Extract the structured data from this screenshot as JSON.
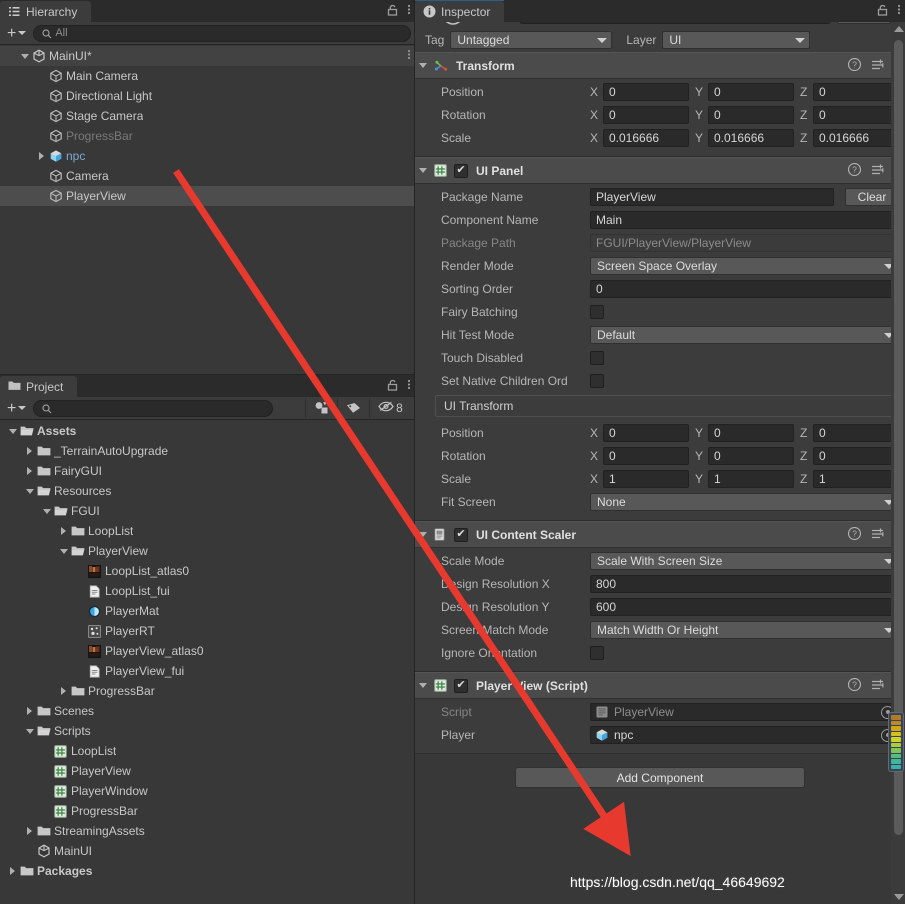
{
  "hierarchy": {
    "tab_label": "Hierarchy",
    "tab_icon": "hierarchy-icon",
    "toolbar": {
      "add_label": "+",
      "search_placeholder": "All",
      "search_value": ""
    },
    "items": [
      {
        "label": "MainUI*",
        "icon": "unity-scene-icon",
        "indent": 0,
        "expanded": true,
        "state": "scene-header",
        "kebab": true
      },
      {
        "label": "Main Camera",
        "icon": "gameobject-cube-icon",
        "indent": 1,
        "expanded": null,
        "state": "normal"
      },
      {
        "label": "Directional Light",
        "icon": "gameobject-cube-icon",
        "indent": 1,
        "expanded": null,
        "state": "normal"
      },
      {
        "label": "Stage Camera",
        "icon": "gameobject-cube-icon",
        "indent": 1,
        "expanded": null,
        "state": "normal"
      },
      {
        "label": "ProgressBar",
        "icon": "gameobject-cube-icon",
        "indent": 1,
        "expanded": null,
        "state": "disabled"
      },
      {
        "label": "npc",
        "icon": "prefab-cube-icon",
        "indent": 1,
        "expanded": false,
        "state": "prefab"
      },
      {
        "label": "Camera",
        "icon": "gameobject-cube-icon",
        "indent": 1,
        "expanded": null,
        "state": "normal"
      },
      {
        "label": "PlayerView",
        "icon": "gameobject-cube-icon",
        "indent": 1,
        "expanded": null,
        "state": "selected"
      }
    ]
  },
  "project": {
    "tab_label": "Project",
    "tab_icon": "folder-icon",
    "toolbar": {
      "add_label": "+",
      "search_placeholder": "",
      "search_value": "",
      "filter_type_icon": "filter-by-type-icon",
      "filter_label_icon": "filter-by-label-icon",
      "hidden_count_icon": "visibility-off-icon",
      "hidden_count": "8"
    },
    "items": [
      {
        "label": "Assets",
        "icon": "folder-open-icon",
        "indent": 0,
        "expanded": true,
        "bold": true
      },
      {
        "label": "_TerrainAutoUpgrade",
        "icon": "folder-icon",
        "indent": 1,
        "expanded": false
      },
      {
        "label": "FairyGUI",
        "icon": "folder-icon",
        "indent": 1,
        "expanded": false
      },
      {
        "label": "Resources",
        "icon": "folder-open-icon",
        "indent": 1,
        "expanded": true
      },
      {
        "label": "FGUI",
        "icon": "folder-open-icon",
        "indent": 2,
        "expanded": true
      },
      {
        "label": "LoopList",
        "icon": "folder-icon",
        "indent": 3,
        "expanded": false
      },
      {
        "label": "PlayerView",
        "icon": "folder-open-icon",
        "indent": 3,
        "expanded": true
      },
      {
        "label": "LoopList_atlas0",
        "icon": "texture-atlas-icon",
        "indent": 4,
        "expanded": null
      },
      {
        "label": "LoopList_fui",
        "icon": "text-asset-icon",
        "indent": 4,
        "expanded": null
      },
      {
        "label": "PlayerMat",
        "icon": "material-icon",
        "indent": 4,
        "expanded": null
      },
      {
        "label": "PlayerRT",
        "icon": "render-texture-icon",
        "indent": 4,
        "expanded": null
      },
      {
        "label": "PlayerView_atlas0",
        "icon": "texture-atlas-icon",
        "indent": 4,
        "expanded": null
      },
      {
        "label": "PlayerView_fui",
        "icon": "text-asset-icon",
        "indent": 4,
        "expanded": null
      },
      {
        "label": "ProgressBar",
        "icon": "folder-icon",
        "indent": 3,
        "expanded": false
      },
      {
        "label": "Scenes",
        "icon": "folder-icon",
        "indent": 1,
        "expanded": false
      },
      {
        "label": "Scripts",
        "icon": "folder-open-icon",
        "indent": 1,
        "expanded": true
      },
      {
        "label": "LoopList",
        "icon": "csharp-script-icon",
        "indent": 2,
        "expanded": null
      },
      {
        "label": "PlayerView",
        "icon": "csharp-script-icon",
        "indent": 2,
        "expanded": null
      },
      {
        "label": "PlayerWindow",
        "icon": "csharp-script-icon",
        "indent": 2,
        "expanded": null
      },
      {
        "label": "ProgressBar",
        "icon": "csharp-script-icon",
        "indent": 2,
        "expanded": null
      },
      {
        "label": "StreamingAssets",
        "icon": "folder-icon",
        "indent": 1,
        "expanded": false
      },
      {
        "label": "MainUI",
        "icon": "unity-scene-icon",
        "indent": 1,
        "expanded": null
      },
      {
        "label": "Packages",
        "icon": "folder-icon",
        "indent": 0,
        "expanded": false,
        "bold": true
      }
    ]
  },
  "inspector": {
    "tab_label": "Inspector",
    "tab_icon": "info-icon",
    "tag_label": "Tag",
    "tag_value": "Untagged",
    "layer_label": "Layer",
    "layer_value": "UI",
    "components": [
      {
        "name": "Transform",
        "icon": "transform-icon",
        "has_checkbox": false,
        "expanded": true,
        "rows": [
          {
            "type": "vector3",
            "label": "Position",
            "x": "0",
            "y": "0",
            "z": "0"
          },
          {
            "type": "vector3",
            "label": "Rotation",
            "x": "0",
            "y": "0",
            "z": "0"
          },
          {
            "type": "vector3",
            "label": "Scale",
            "x": "0.016666",
            "y": "0.016666",
            "z": "0.016666"
          }
        ]
      },
      {
        "name": "UI Panel",
        "icon": "csharp-script-icon",
        "has_checkbox": true,
        "checked": true,
        "expanded": true,
        "rows": [
          {
            "type": "text-with-button",
            "label": "Package Name",
            "value": "PlayerView",
            "button": "Clear"
          },
          {
            "type": "text",
            "label": "Component Name",
            "value": "Main"
          },
          {
            "type": "text-readonly",
            "label": "Package Path",
            "value": "FGUI/PlayerView/PlayerView"
          },
          {
            "type": "dropdown",
            "label": "Render Mode",
            "value": "Screen Space Overlay"
          },
          {
            "type": "text",
            "label": "Sorting Order",
            "value": "0"
          },
          {
            "type": "checkbox",
            "label": "Fairy Batching",
            "checked": false
          },
          {
            "type": "dropdown",
            "label": "Hit Test Mode",
            "value": "Default"
          },
          {
            "type": "checkbox",
            "label": "Touch Disabled",
            "checked": false
          },
          {
            "type": "checkbox",
            "label": "Set Native Children Ord",
            "checked": false
          },
          {
            "type": "group-title",
            "label": "UI Transform"
          },
          {
            "type": "vector3",
            "label": "Position",
            "x": "0",
            "y": "0",
            "z": "0"
          },
          {
            "type": "vector3",
            "label": "Rotation",
            "x": "0",
            "y": "0",
            "z": "0"
          },
          {
            "type": "vector3",
            "label": "Scale",
            "x": "1",
            "y": "1",
            "z": "1"
          },
          {
            "type": "dropdown",
            "label": "Fit Screen",
            "value": "None"
          }
        ]
      },
      {
        "name": "UI Content Scaler",
        "icon": "csharp-script-icon",
        "has_checkbox": true,
        "checked": true,
        "expanded": true,
        "rows": [
          {
            "type": "dropdown",
            "label": "Scale Mode",
            "value": "Scale With Screen Size"
          },
          {
            "type": "text",
            "label": "Design Resolution X",
            "value": "800"
          },
          {
            "type": "text",
            "label": "Design Resolution Y",
            "value": "600"
          },
          {
            "type": "dropdown",
            "label": "Screen Match Mode",
            "value": "Match Width Or Height"
          },
          {
            "type": "checkbox",
            "label": "Ignore Orientation",
            "checked": false
          }
        ]
      },
      {
        "name": "Player View (Script)",
        "icon": "csharp-script-icon",
        "has_checkbox": true,
        "checked": true,
        "expanded": true,
        "rows": [
          {
            "type": "object-readonly",
            "label": "Script",
            "value": "PlayerView",
            "obj_icon": "script-asset-icon"
          },
          {
            "type": "object",
            "label": "Player",
            "value": "npc",
            "obj_icon": "prefab-cube-icon"
          }
        ]
      }
    ],
    "add_component_label": "Add Component",
    "watermark": "https://blog.csdn.net/qq_46649692"
  },
  "axis_labels": {
    "x": "X",
    "y": "Y",
    "z": "Z"
  },
  "colors": {
    "panel_bg": "#383838",
    "header_bg": "#4b4b4b",
    "field_bg": "#2a2a2a",
    "selection": "#4d4d4d",
    "prefab_text": "#7ba8d1",
    "accent_tab": "#2c5d87",
    "arrow": "#e8392f"
  }
}
